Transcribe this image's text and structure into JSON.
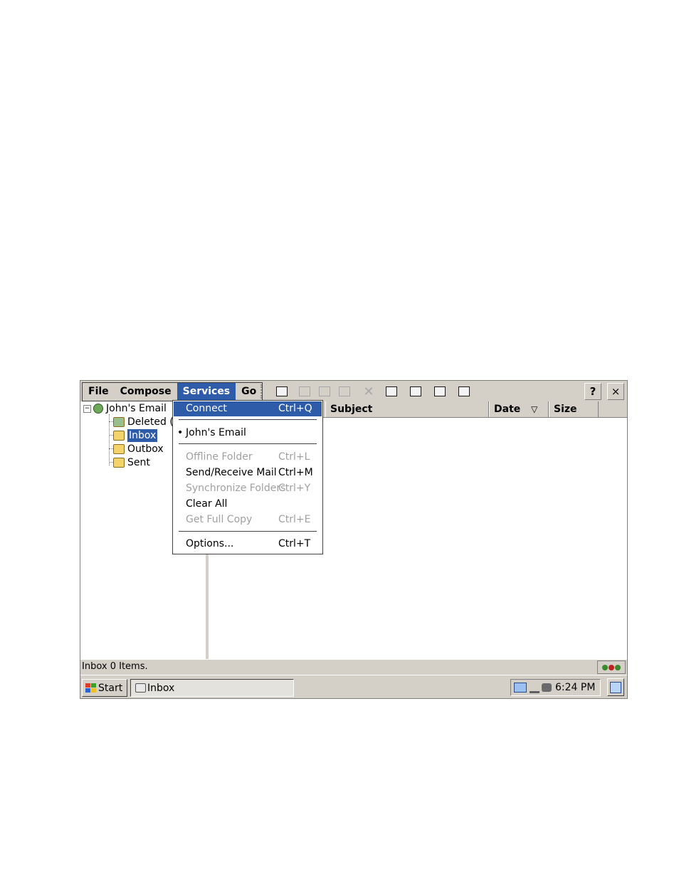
{
  "menubar": {
    "file": "File",
    "compose": "Compose",
    "services": "Services",
    "go": "Go"
  },
  "toolbar": {
    "help_label": "?",
    "close_label": "×"
  },
  "tree": {
    "root": "John's Email",
    "expander": "⊟",
    "items": [
      {
        "label": "Deleted (",
        "icon": "recycle-folder-icon"
      },
      {
        "label": "Inbox",
        "icon": "inbox-folder-icon",
        "selected": true
      },
      {
        "label": "Outbox",
        "icon": "outbox-folder-icon"
      },
      {
        "label": "Sent",
        "icon": "sent-folder-icon"
      }
    ]
  },
  "columns": {
    "subject": "Subject",
    "date": "Date",
    "sort_indicator": "▽",
    "size": "Size"
  },
  "services_menu": {
    "items": [
      {
        "label": "Connect",
        "shortcut": "Ctrl+Q",
        "state": "highlighted"
      },
      {
        "label": "John's Email",
        "bullet": "•",
        "state": "checked"
      },
      {
        "label": "Offline Folder",
        "shortcut": "Ctrl+L",
        "state": "disabled"
      },
      {
        "label": "Send/Receive Mail",
        "shortcut": "Ctrl+M",
        "state": "enabled"
      },
      {
        "label": "Synchronize Folders",
        "shortcut": "Ctrl+Y",
        "state": "disabled"
      },
      {
        "label": "Clear All",
        "shortcut": "",
        "state": "enabled"
      },
      {
        "label": "Get Full Copy",
        "shortcut": "Ctrl+E",
        "state": "disabled"
      },
      {
        "label": "Options...",
        "shortcut": "Ctrl+T",
        "state": "enabled"
      }
    ]
  },
  "statusbar": {
    "text": "Inbox 0 Items."
  },
  "taskbar": {
    "start": "Start",
    "task": "Inbox",
    "clock": "6:24 PM"
  },
  "colors": {
    "selection": "#2f5ca8",
    "chrome": "#d4d0c8"
  }
}
